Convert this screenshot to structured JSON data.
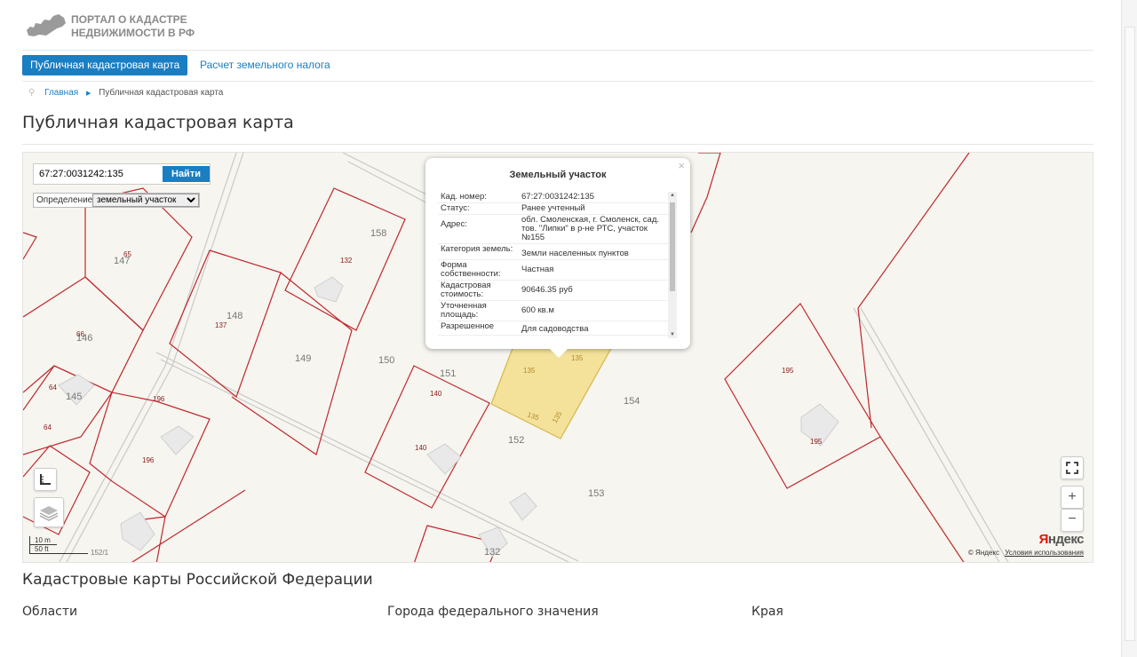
{
  "header": {
    "logo_line1": "ПОРТАЛ О КАДАСТРЕ",
    "logo_line2": "НЕДВИЖИМОСТИ В РФ"
  },
  "nav": {
    "tab_active": "Публичная кадастровая карта",
    "tab_link": "Расчет земельного налога"
  },
  "breadcrumb": {
    "home": "Главная",
    "current": "Публичная кадастровая карта"
  },
  "page_title": "Публичная кадастровая карта",
  "map": {
    "search_value": "67:27:0031242:135",
    "search_button": "Найти",
    "definition_label": "Определение:",
    "definition_selected": "земельный участок",
    "popup": {
      "title": "Земельный участок",
      "close": "×",
      "rows": [
        {
          "k": "Кад. номер:",
          "v": "67:27:0031242:135"
        },
        {
          "k": "Статус:",
          "v": "Ранее учтенный"
        },
        {
          "k": "Адрес:",
          "v": "обл. Смоленская, г. Смоленск, сад. тов. \"Липки\" в р-не РТС, участок №155"
        },
        {
          "k": "Категория земель:",
          "v": "Земли населенных пунктов"
        },
        {
          "k": "Форма собственности:",
          "v": "Частная"
        },
        {
          "k": "Кадастровая стоимость:",
          "v": "90646.35 руб"
        },
        {
          "k": "Уточненная площадь:",
          "v": "600 кв.м"
        },
        {
          "k": "Разрешенное",
          "v": "Для садоводства"
        }
      ]
    },
    "parcel_labels": [
      "147",
      "146",
      "145",
      "148",
      "149",
      "150",
      "151",
      "152",
      "153",
      "154",
      "158",
      "195",
      "132",
      "152/1"
    ],
    "small_labels": [
      "65",
      "66",
      "64",
      "64",
      "137",
      "132",
      "196",
      "196",
      "140",
      "140",
      "135",
      "135",
      "135",
      "135",
      "195",
      "195"
    ],
    "zoom_in": "+",
    "zoom_out": "−",
    "scale_m": "10 m",
    "scale_ft": "50 ft",
    "copyright": "© Яндекс",
    "terms": "Условия использования",
    "brand_first": "Я",
    "brand_rest": "ндекс"
  },
  "section_title": "Кадастровые карты Российской Федерации",
  "columns": {
    "c1": "Области",
    "c2": "Города федерального значения",
    "c3": "Края"
  }
}
